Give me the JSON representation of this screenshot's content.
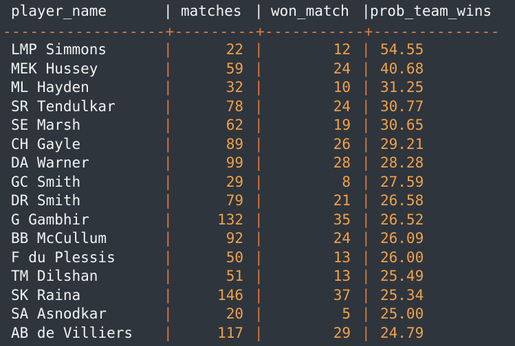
{
  "table": {
    "columns": [
      "player_name",
      "matches",
      "won_match",
      "prob_team_wins"
    ],
    "separator": "------------------+---------+-----------+--------------",
    "pipe": "|",
    "rows": [
      {
        "player_name": "LMP Simmons",
        "matches": "22",
        "won_match": "12",
        "prob_team_wins": "54.55"
      },
      {
        "player_name": "MEK Hussey",
        "matches": "59",
        "won_match": "24",
        "prob_team_wins": "40.68"
      },
      {
        "player_name": "ML Hayden",
        "matches": "32",
        "won_match": "10",
        "prob_team_wins": "31.25"
      },
      {
        "player_name": "SR Tendulkar",
        "matches": "78",
        "won_match": "24",
        "prob_team_wins": "30.77"
      },
      {
        "player_name": "SE Marsh",
        "matches": "62",
        "won_match": "19",
        "prob_team_wins": "30.65"
      },
      {
        "player_name": "CH Gayle",
        "matches": "89",
        "won_match": "26",
        "prob_team_wins": "29.21"
      },
      {
        "player_name": "DA Warner",
        "matches": "99",
        "won_match": "28",
        "prob_team_wins": "28.28"
      },
      {
        "player_name": "GC Smith",
        "matches": "29",
        "won_match": "8",
        "prob_team_wins": "27.59"
      },
      {
        "player_name": "DR Smith",
        "matches": "79",
        "won_match": "21",
        "prob_team_wins": "26.58"
      },
      {
        "player_name": "G Gambhir",
        "matches": "132",
        "won_match": "35",
        "prob_team_wins": "26.52"
      },
      {
        "player_name": "BB McCullum",
        "matches": "92",
        "won_match": "24",
        "prob_team_wins": "26.09"
      },
      {
        "player_name": "F du Plessis",
        "matches": "50",
        "won_match": "13",
        "prob_team_wins": "26.00"
      },
      {
        "player_name": "TM Dilshan",
        "matches": "51",
        "won_match": "13",
        "prob_team_wins": "25.49"
      },
      {
        "player_name": "SK Raina",
        "matches": "146",
        "won_match": "37",
        "prob_team_wins": "25.34"
      },
      {
        "player_name": "SA Asnodkar",
        "matches": "20",
        "won_match": "5",
        "prob_team_wins": "25.00"
      },
      {
        "player_name": "AB de Villiers",
        "matches": "117",
        "won_match": "29",
        "prob_team_wins": "24.79"
      }
    ]
  },
  "colors": {
    "background": "#2f353d",
    "text": "#f2f2f2",
    "accent_orange": "#e07b3f",
    "number_orange": "#f0a24a"
  }
}
